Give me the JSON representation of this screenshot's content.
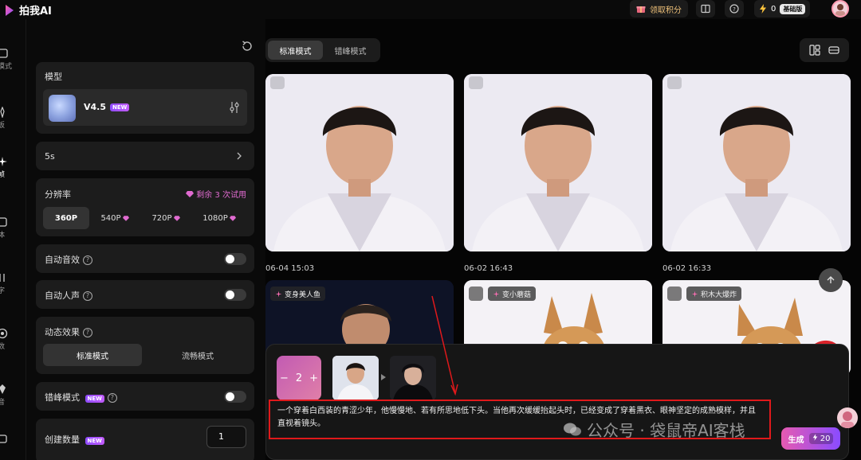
{
  "app": {
    "name": "拍我AI"
  },
  "topbar": {
    "points_label": "领取积分",
    "energy_count": "0",
    "tier_label": "基础版"
  },
  "leftnav": {
    "items": [
      {
        "label": "模式",
        "icon": "video-icon"
      },
      {
        "label": "板",
        "icon": "template-icon"
      },
      {
        "label": "帧",
        "icon": "sparkle-icon"
      },
      {
        "label": "体",
        "icon": "subject-icon"
      },
      {
        "label": "字",
        "icon": "text-icon"
      },
      {
        "label": "数",
        "icon": "effect-icon"
      },
      {
        "label": "音",
        "icon": "audio-icon"
      }
    ]
  },
  "settings": {
    "model": {
      "section_label": "模型",
      "name": "V4.5",
      "badge": "NEW"
    },
    "duration": {
      "value": "5s"
    },
    "resolution": {
      "label": "分辨率",
      "trial_text": "剩余 3 次试用",
      "options": [
        "360P",
        "540P",
        "720P",
        "1080P"
      ],
      "selected": "360P"
    },
    "auto_sfx": {
      "label": "自动音效",
      "enabled": false
    },
    "auto_voice": {
      "label": "自动人声",
      "enabled": false
    },
    "motion": {
      "label": "动态效果",
      "options": [
        "标准模式",
        "流畅模式"
      ],
      "selected": "标准模式"
    },
    "offpeak": {
      "label": "错峰模式",
      "badge": "NEW",
      "enabled": false
    },
    "count": {
      "label": "创建数量",
      "badge": "NEW",
      "value": "1"
    }
  },
  "main": {
    "mode_tabs": [
      "标准模式",
      "错峰模式"
    ],
    "active_mode": "标准模式",
    "row1": [
      {
        "timestamp": "06-04 15:03"
      },
      {
        "timestamp": "06-02 16:43"
      },
      {
        "timestamp": "06-02 16:33"
      }
    ],
    "row2": [
      {
        "effect": "变身美人鱼"
      },
      {
        "effect": "变小蘑菇"
      },
      {
        "effect": "积木大爆炸"
      }
    ]
  },
  "prompt": {
    "stepper_value": "2",
    "text": "一个穿着白西装的青涩少年，他慢慢地、若有所思地低下头。当他再次缓缓抬起头时，已经变成了穿着黑衣、眼神坚定的成熟模样，并且直视着镜头。",
    "generate_label": "生成",
    "generate_cost": "20"
  },
  "watermark": {
    "text": "公众号 · 袋鼠帝AI客栈"
  },
  "colors": {
    "accent_pink": "#e65ab1",
    "accent_purple": "#8a4cff",
    "highlight_red": "#e0191b"
  }
}
